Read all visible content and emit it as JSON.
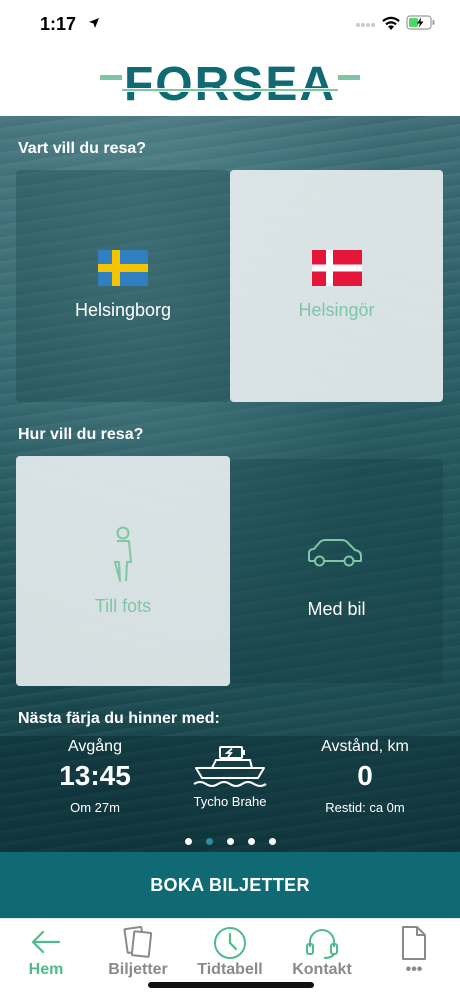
{
  "status_bar": {
    "time": "1:17"
  },
  "header": {
    "logo_text": "FORSEA"
  },
  "destination": {
    "title": "Vart vill du resa?",
    "options": [
      {
        "label": "Helsingborg",
        "flag": "sweden-flag-icon",
        "selected": false
      },
      {
        "label": "Helsingör",
        "flag": "denmark-flag-icon",
        "selected": true
      }
    ]
  },
  "travel_mode": {
    "title": "Hur vill du resa?",
    "options": [
      {
        "label": "Till fots",
        "icon": "walking-person-icon",
        "selected": true
      },
      {
        "label": "Med bil",
        "icon": "car-icon",
        "selected": false
      }
    ]
  },
  "next_ferry": {
    "title": "Nästa färja du hinner med:",
    "departure_label": "Avgång",
    "departure_time": "13:45",
    "departure_in": "Om 27m",
    "ship_name": "Tycho Brahe",
    "distance_label": "Avstånd, km",
    "distance_value": "0",
    "travel_time": "Restid: ca 0m",
    "page_count": 5,
    "active_page": 1
  },
  "book_button": {
    "label": "BOKA BILJETTER"
  },
  "tabbar": {
    "items": [
      {
        "label": "Hem",
        "icon": "arrow-left-icon",
        "active": true
      },
      {
        "label": "Biljetter",
        "icon": "tickets-icon",
        "active": false
      },
      {
        "label": "Tidtabell",
        "icon": "clock-icon",
        "active": false
      },
      {
        "label": "Kontakt",
        "icon": "headset-icon",
        "active": false
      },
      {
        "label": "•••",
        "icon": "document-icon",
        "active": false
      }
    ]
  },
  "colors": {
    "brand_teal": "#0f6a73",
    "accent_green": "#4dbb8e",
    "logo_green": "#7fc6a4"
  }
}
